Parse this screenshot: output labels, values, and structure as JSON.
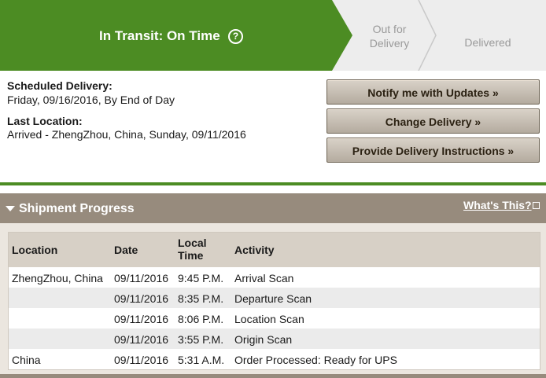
{
  "progress": {
    "current_status": "In Transit: On Time",
    "help_glyph": "?",
    "steps": [
      "Out for Delivery",
      "Delivered"
    ],
    "colors": {
      "active": "#4c8c23",
      "inactive": "#ededed"
    }
  },
  "summary": {
    "scheduled_label": "Scheduled Delivery:",
    "scheduled_value": "Friday, 09/16/2016, By End of Day",
    "last_location_label": "Last Location:",
    "last_location_value": "Arrived - ZhengZhou, China, Sunday, 09/11/2016"
  },
  "actions": {
    "notify": "Notify me with Updates »",
    "change": "Change Delivery »",
    "instructions": "Provide Delivery Instructions »"
  },
  "shipment_progress": {
    "title": "Shipment Progress",
    "whats_this": "What's This?",
    "columns": [
      "Location",
      "Date",
      "Local Time",
      "Activity"
    ],
    "rows": [
      {
        "location": "ZhengZhou, China",
        "date": "09/11/2016",
        "time": "9:45 P.M.",
        "activity": "Arrival Scan"
      },
      {
        "location": "",
        "date": "09/11/2016",
        "time": "8:35 P.M.",
        "activity": "Departure Scan"
      },
      {
        "location": "",
        "date": "09/11/2016",
        "time": "8:06 P.M.",
        "activity": "Location Scan"
      },
      {
        "location": "",
        "date": "09/11/2016",
        "time": "3:55 P.M.",
        "activity": "Origin Scan"
      },
      {
        "location": "China",
        "date": "09/11/2016",
        "time": "5:31 A.M.",
        "activity": "Order Processed: Ready for UPS"
      }
    ]
  }
}
